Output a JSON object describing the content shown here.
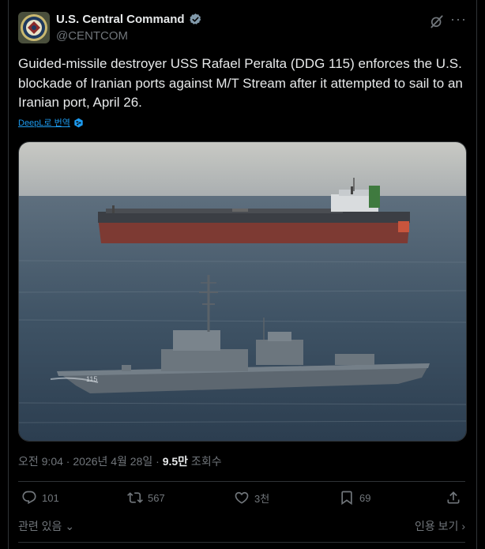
{
  "account": {
    "name": "U.S. Central Command",
    "handle": "@CENTCOM",
    "verified": true
  },
  "tweet": {
    "text": "Guided-missile destroyer USS Rafael Peralta (DDG 115) enforces the U.S. blockade of Iranian ports against M/T Stream after it attempted to sail to an Iranian port, April 26.",
    "translate_label": "DeepL로 번역"
  },
  "media": {
    "hull_number": "115"
  },
  "meta": {
    "timestamp": "오전 9:04 · 2026년 4월 28일 · ",
    "views_count": "9.5만",
    "views_label": " 조회수"
  },
  "actions": {
    "replies": "101",
    "reposts": "567",
    "likes": "3천",
    "bookmarks": "69"
  },
  "footer": {
    "related": "관련 있음",
    "quotes": "인용 보기"
  },
  "colors": {
    "background": "#000000",
    "text_primary": "#e7e9ea",
    "text_secondary": "#71767b",
    "link": "#1d9bf0",
    "divider": "#2f3336"
  }
}
